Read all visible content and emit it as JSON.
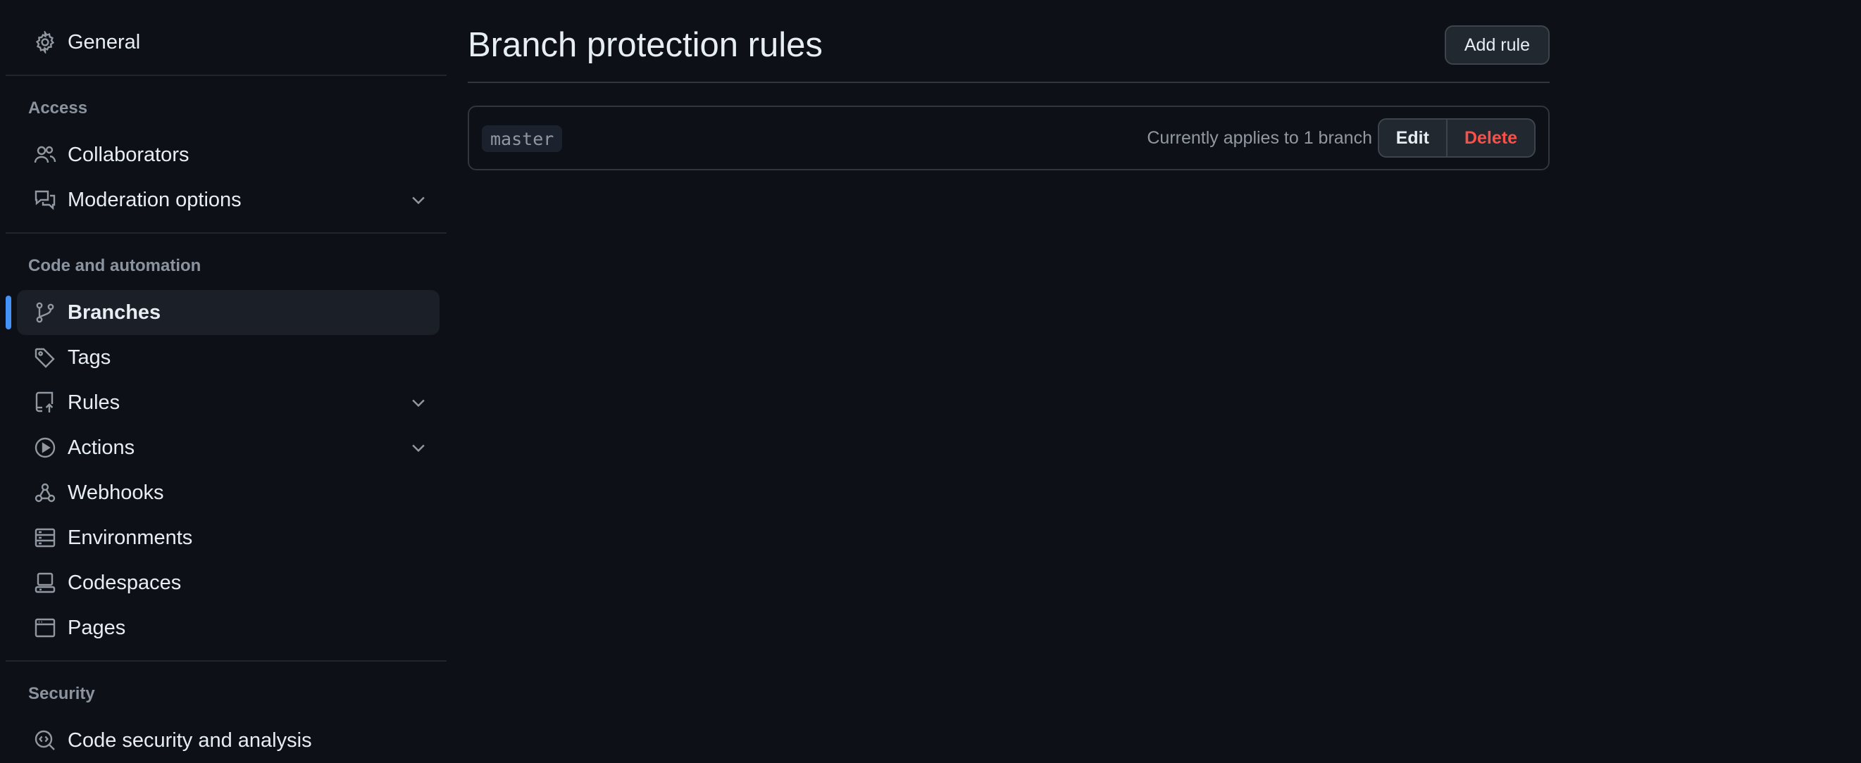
{
  "sidebar": {
    "general": {
      "label": "General",
      "icon": "gear-icon"
    },
    "access_heading": "Access",
    "collaborators": {
      "label": "Collaborators",
      "icon": "people-icon"
    },
    "moderation": {
      "label": "Moderation options",
      "icon": "comment-discussion-icon"
    },
    "code_heading": "Code and automation",
    "branches": {
      "label": "Branches",
      "icon": "git-branch-icon",
      "active": true
    },
    "tags": {
      "label": "Tags",
      "icon": "tag-icon"
    },
    "rules": {
      "label": "Rules",
      "icon": "repo-push-icon"
    },
    "actions": {
      "label": "Actions",
      "icon": "play-icon"
    },
    "webhooks": {
      "label": "Webhooks",
      "icon": "webhook-icon"
    },
    "environments": {
      "label": "Environments",
      "icon": "server-icon"
    },
    "codespaces": {
      "label": "Codespaces",
      "icon": "codespaces-icon"
    },
    "pages": {
      "label": "Pages",
      "icon": "browser-icon"
    },
    "security_heading": "Security",
    "code_security": {
      "label": "Code security and analysis",
      "icon": "codescan-icon"
    }
  },
  "main": {
    "title": "Branch protection rules",
    "add_rule_label": "Add rule",
    "rules": [
      {
        "branch": "master",
        "applies_text": "Currently applies to 1 branch",
        "edit_label": "Edit",
        "delete_label": "Delete"
      }
    ]
  },
  "colors": {
    "background": "#0d1117",
    "active_indicator": "#4493f8",
    "danger": "#f85149",
    "muted_text": "#8b949e"
  }
}
